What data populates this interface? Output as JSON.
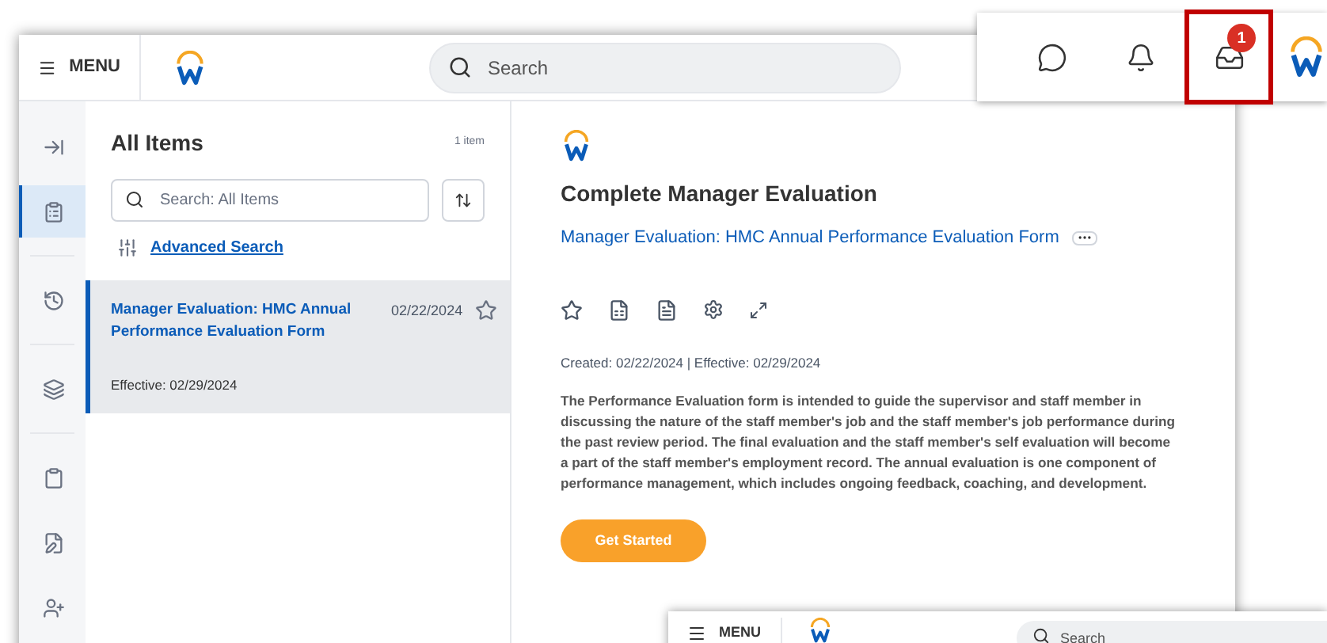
{
  "header": {
    "menu_label": "MENU",
    "search_placeholder": "Search"
  },
  "rail": [
    {
      "kind": "collapse",
      "selected": false
    },
    {
      "kind": "tasks",
      "selected": true
    },
    {
      "kind": "history",
      "selected": false
    },
    {
      "kind": "layers",
      "selected": false
    },
    {
      "kind": "clipboard",
      "selected": false
    },
    {
      "kind": "edit",
      "selected": false
    },
    {
      "kind": "person-add",
      "selected": false
    }
  ],
  "list": {
    "title": "All Items",
    "count": "1 item",
    "search_placeholder": "Search: All Items",
    "advanced_search": "Advanced Search",
    "items": [
      {
        "title": "Manager Evaluation: HMC Annual Performance Evaluation Form",
        "date": "02/22/2024",
        "effective": "Effective: 02/29/2024",
        "selected": true,
        "starred": false
      }
    ]
  },
  "detail": {
    "title": "Complete Manager Evaluation",
    "link": "Manager Evaluation: HMC Annual Performance Evaluation Form",
    "dates": "Created: 02/22/2024 | Effective: 02/29/2024",
    "description": "The Performance Evaluation form is intended to guide the supervisor and staff member in discussing the nature of the staff member's job and the staff member's job performance during the past review period. The final evaluation and the staff member's self evaluation will become a part of the staff member's employment record. The annual evaluation is one component of performance management, which includes ongoing feedback, coaching, and development.",
    "button": "Get Started"
  },
  "top_toolbar": {
    "items": [
      {
        "kind": "chat",
        "highlighted": false
      },
      {
        "kind": "bell",
        "highlighted": false
      },
      {
        "kind": "inbox",
        "highlighted": true,
        "badge": "1"
      }
    ]
  },
  "second_window": {
    "menu_label": "MENU",
    "search_placeholder": "Search"
  }
}
